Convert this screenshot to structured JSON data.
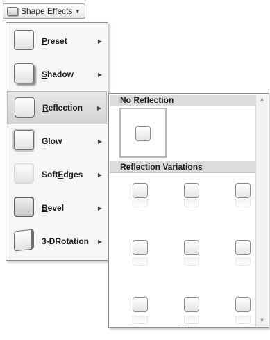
{
  "ribbon": {
    "button_label": "Shape Effects",
    "chevron": "▾"
  },
  "menu": {
    "items": [
      {
        "label": "Preset",
        "mnemonic": "P",
        "icon": "preset-icon"
      },
      {
        "label": "Shadow",
        "mnemonic": "S",
        "icon": "shadow-icon"
      },
      {
        "label": "Reflection",
        "mnemonic": "R",
        "icon": "reflection-icon",
        "active": true
      },
      {
        "label": "Glow",
        "mnemonic": "G",
        "icon": "glow-icon"
      },
      {
        "label": "Soft Edges",
        "mnemonic": "E",
        "icon": "soft-edges-icon"
      },
      {
        "label": "Bevel",
        "mnemonic": "B",
        "icon": "bevel-icon"
      },
      {
        "label": "3-D Rotation",
        "mnemonic": "D",
        "icon": "3d-rotation-icon"
      }
    ],
    "arrow": "▶"
  },
  "gallery": {
    "no_reflection_header": "No Reflection",
    "variations_header": "Reflection Variations",
    "variation_rows": 3,
    "variation_cols": 3,
    "grip": "····"
  }
}
